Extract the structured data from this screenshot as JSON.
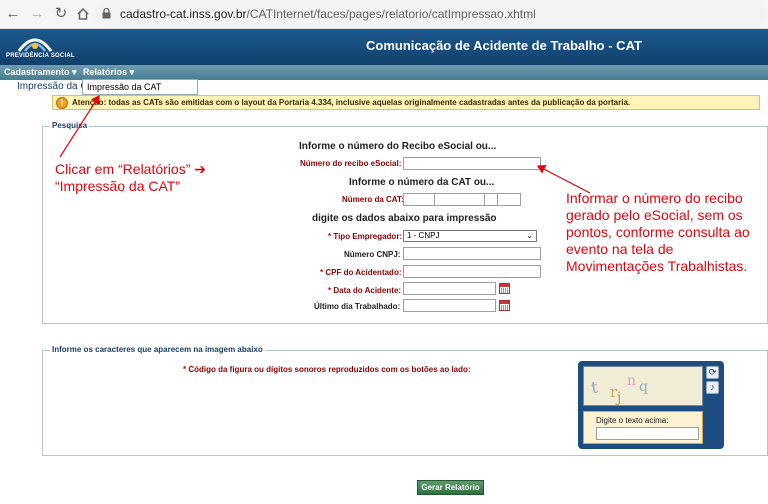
{
  "browser": {
    "url_host": "cadastro-cat.inss.gov.br",
    "url_path": "/CATInternet/faces/pages/relatorio/catImpressao.xhtml"
  },
  "header": {
    "logo_text": "PREVIDÊNCIA SOCIAL",
    "title": "Comunicação de Acidente de Trabalho - CAT"
  },
  "menu": {
    "items": [
      "Cadastramento ▾",
      "Relatórios ▾"
    ],
    "dropdown_item": "Impressão da CAT"
  },
  "breadcrumb": "Impressão da CAT",
  "attention": "Atenção: todas as CATs são emitidas com o layout da Portaria 4.334, inclusive aquelas originalmente cadastradas antes da publicação da portaria.",
  "form": {
    "legend": "Pesquisa",
    "heading_recibo": "Informe o número do Recibo eSocial ou...",
    "label_recibo": "Número do recibo eSocial:",
    "heading_cat": "Informe o número da CAT ou...",
    "label_cat": "Número da CAT:",
    "heading_dados": "digite os dados abaixo para impressão",
    "label_tipo": "Tipo Empregador:",
    "tipo_value": "1 - CNPJ",
    "label_cnpj": "Número CNPJ:",
    "label_cpf": "CPF do Acidentado:",
    "label_data": "Data do Acidente:",
    "label_ultimo": "Último dia Trabalhado:"
  },
  "captcha": {
    "legend": "Informe os caracteres que aparecem na imagem abaixo",
    "instruction": "Código da figura ou dígitos sonoros reproduzidos com os botões ao lado:",
    "chars": "trjnq",
    "input_label": "Digite o texto acima:"
  },
  "submit_label": "Gerar Relatório",
  "annotations": {
    "left_line1": "Clicar em “Relatórios” ➔",
    "left_line2": "“Impressão da CAT”",
    "right_lines": [
      "Informar o número do recibo",
      "gerado pelo eSocial, sem os",
      "pontos, conforme consulta ao",
      "evento na tela de",
      "Movimentações Trabalhistas."
    ]
  },
  "colors": {
    "header": "#11406c",
    "menubar": "#477c8f",
    "annotation": "#e8000b",
    "button": "#2f7042"
  }
}
